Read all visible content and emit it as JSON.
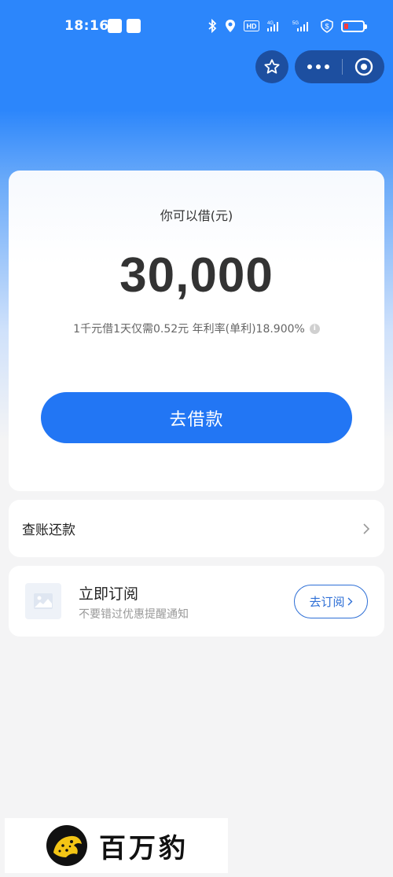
{
  "status_bar": {
    "time": "18:16",
    "app_badge_1": "",
    "app_badge_2": "",
    "signal_1": "4G",
    "signal_2": "5G",
    "hd": "HD",
    "battery_level_percent": 15
  },
  "capsule": {
    "favorite_icon": "star-icon",
    "more_icon": "more-dots-icon",
    "close_icon": "target-circle-icon"
  },
  "loan": {
    "label": "你可以借(元)",
    "amount": "30,000",
    "rate_text": "1千元借1天仅需0.52元 年利率(单利)18.900%",
    "info_icon": "i",
    "button_label": "去借款"
  },
  "bill": {
    "label": "查账还款",
    "chevron_icon": "chevron-right-icon"
  },
  "subscribe": {
    "title": "立即订阅",
    "description": "不要错过优惠提醒通知",
    "button_label": "去订阅",
    "thumb_icon": "image-placeholder-icon"
  },
  "watermark": {
    "text": "百万豹"
  },
  "colors": {
    "primary": "#2276f4",
    "header_blue": "#2c86fb",
    "capsule_bg": "#1d4fa0",
    "page_bg": "#f4f4f5"
  }
}
